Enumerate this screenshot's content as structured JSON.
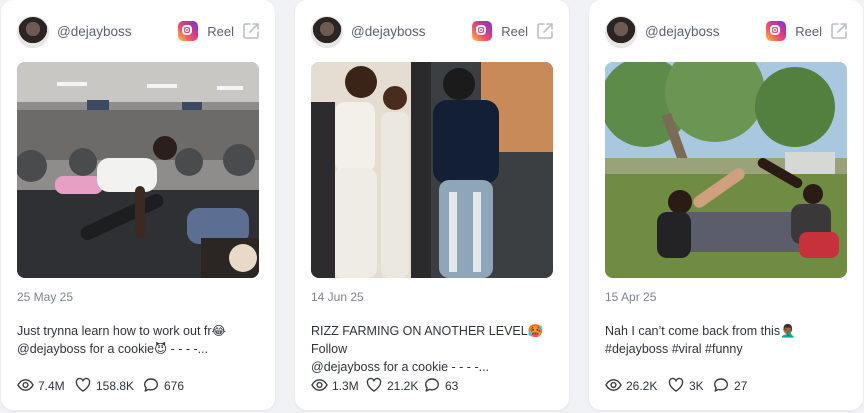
{
  "cards": [
    {
      "handle": "@dejayboss",
      "type_label": "Reel",
      "date": "25 May 25",
      "caption": "Just trynna learn how to work out fr😂\n@dejayboss for a cookie😈 - - - -...",
      "stats": {
        "views": "7.4M",
        "likes": "158.8K",
        "comments": "676"
      }
    },
    {
      "handle": "@dejayboss",
      "type_label": "Reel",
      "date": "14 Jun 25",
      "caption": "RIZZ FARMING ON ANOTHER LEVEL🥵 Follow\n@dejayboss for a cookie - - - -...",
      "stats": {
        "views": "1.3M",
        "likes": "21.2K",
        "comments": "63"
      }
    },
    {
      "handle": "@dejayboss",
      "type_label": "Reel",
      "date": "15 Apr 25",
      "caption": "Nah I can’t come back from this🤦🏾‍♂️\n#dejayboss #viral #funny",
      "stats": {
        "views": "26.2K",
        "likes": "3K",
        "comments": "27"
      }
    }
  ],
  "icons": {
    "instagram": "instagram-icon",
    "external_link": "external-link-icon",
    "views": "eye-icon",
    "likes": "heart-icon",
    "comments": "comment-icon"
  }
}
